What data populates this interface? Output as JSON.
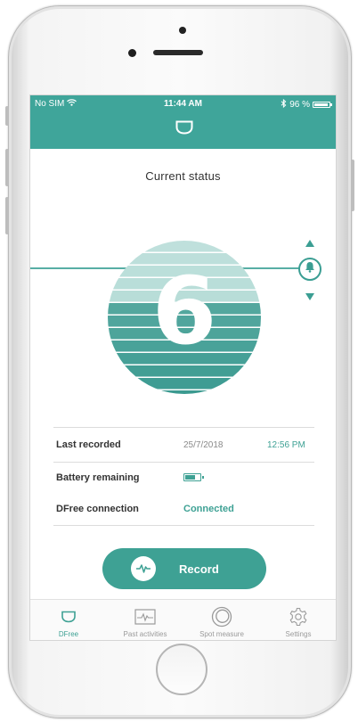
{
  "status_bar": {
    "carrier": "No SIM",
    "time": "11:44 AM",
    "battery_text": "96 %",
    "battery_level": 0.96
  },
  "header": {
    "icon": "dfree-device-icon"
  },
  "main": {
    "title": "Current status",
    "gauge_value": "6",
    "gauge_level": 0.6,
    "rows": {
      "last_recorded": {
        "label": "Last recorded",
        "date": "25/7/2018",
        "time": "12:56 PM"
      },
      "battery": {
        "label": "Battery remaining",
        "level": 0.75
      },
      "connection": {
        "label": "DFree connection",
        "status": "Connected"
      }
    },
    "record_label": "Record"
  },
  "tabs": [
    {
      "label": "DFree",
      "icon": "dfree-device-icon",
      "active": true
    },
    {
      "label": "Past activities",
      "icon": "chart-pulse-icon",
      "active": false
    },
    {
      "label": "Spot measure",
      "icon": "ring-icon",
      "active": false
    },
    {
      "label": "Settings",
      "icon": "gear-icon",
      "active": false
    }
  ],
  "colors": {
    "accent": "#3fa59a",
    "gauge_light": "#a9d6d0",
    "gauge_dark": "#3a9a90"
  }
}
